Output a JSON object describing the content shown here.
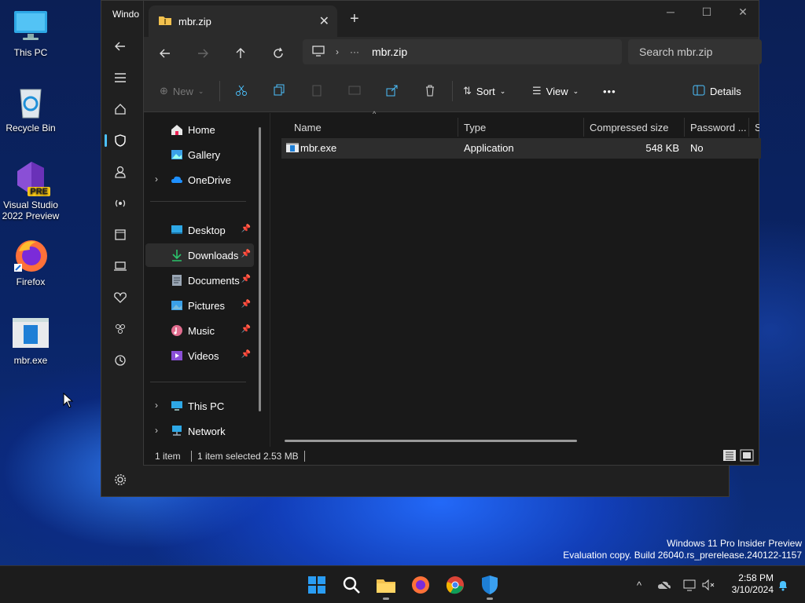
{
  "desktop": {
    "icons": [
      {
        "label": "This PC",
        "icon": "monitor-icon"
      },
      {
        "label": "Recycle Bin",
        "icon": "recycle-bin-icon"
      },
      {
        "label": "Visual Studio 2022 Preview",
        "icon": "visual-studio-icon",
        "badge": "PRE"
      },
      {
        "label": "Firefox",
        "icon": "firefox-icon"
      },
      {
        "label": "mbr.exe",
        "icon": "exe-file-icon"
      }
    ]
  },
  "settings_window": {
    "title": "Windo"
  },
  "explorer": {
    "tab": {
      "title": "mbr.zip"
    },
    "address": {
      "path": "mbr.zip",
      "ellipsis": "···"
    },
    "search": {
      "placeholder": "Search mbr.zip"
    },
    "toolbar": {
      "new_label": "New",
      "sort_label": "Sort",
      "view_label": "View",
      "more_label": "•••",
      "details_label": "Details"
    },
    "navpane": {
      "home": "Home",
      "gallery": "Gallery",
      "onedrive": "OneDrive",
      "desktop": "Desktop",
      "downloads": "Downloads",
      "documents": "Documents",
      "pictures": "Pictures",
      "music": "Music",
      "videos": "Videos",
      "this_pc": "This PC",
      "network": "Network"
    },
    "columns": {
      "name": "Name",
      "type": "Type",
      "compressed_size": "Compressed size",
      "password": "Password ...",
      "size": "Si"
    },
    "files": [
      {
        "name": "mbr.exe",
        "type": "Application",
        "compressed_size": "548 KB",
        "password": "No"
      }
    ],
    "status": {
      "count": "1 item",
      "selected": "1 item selected",
      "size": "2.53 MB"
    }
  },
  "watermark": {
    "line1": "Windows 11 Pro Insider Preview",
    "line2": "Evaluation copy. Build 26040.rs_prerelease.240122-1157"
  },
  "taskbar": {
    "time": "2:58 PM",
    "date": "3/10/2024"
  },
  "colors": {
    "accent": "#4cc2ff",
    "folder": "#f2c14e",
    "window_bg": "#191919"
  }
}
